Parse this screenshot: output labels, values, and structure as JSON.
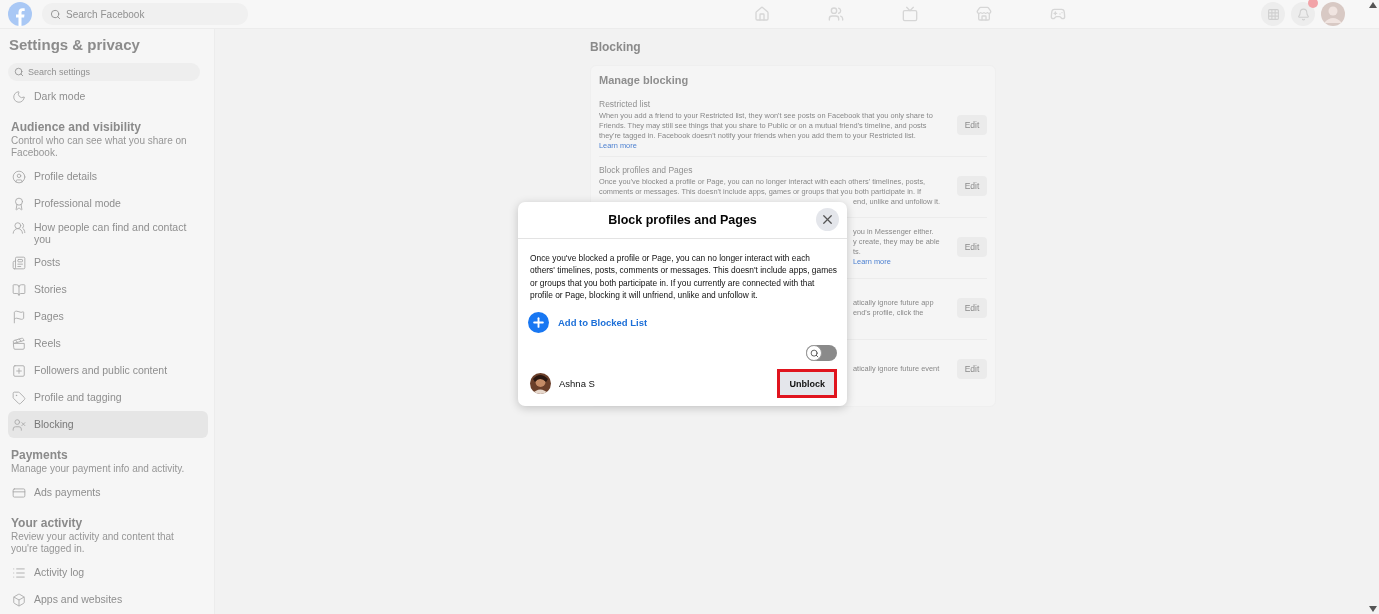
{
  "topbar": {
    "search": {
      "placeholder": "Search Facebook"
    },
    "nav": [
      {
        "kind": "home",
        "selected": false
      },
      {
        "kind": "friends",
        "selected": false
      },
      {
        "kind": "video",
        "selected": false
      },
      {
        "kind": "marketplace",
        "selected": false
      },
      {
        "kind": "gaming",
        "selected": false
      }
    ]
  },
  "sidebar": {
    "title": "Settings & privacy",
    "search": {
      "placeholder": "Search settings"
    },
    "entries": [
      {
        "kind": "item",
        "label": "Dark mode",
        "selected": false
      },
      {
        "kind": "section",
        "label": "Audience and visibility",
        "description": "Control who can see what you share on Facebook."
      },
      {
        "kind": "item",
        "label": "Profile details",
        "selected": false
      },
      {
        "kind": "item",
        "label": "Professional mode",
        "selected": false
      },
      {
        "kind": "item",
        "label": "How people can find and contact you",
        "selected": false
      },
      {
        "kind": "item",
        "label": "Posts",
        "selected": false
      },
      {
        "kind": "item",
        "label": "Stories",
        "selected": false
      },
      {
        "kind": "item",
        "label": "Pages",
        "selected": false
      },
      {
        "kind": "item",
        "label": "Reels",
        "selected": false
      },
      {
        "kind": "item",
        "label": "Followers and public content",
        "selected": false
      },
      {
        "kind": "item",
        "label": "Profile and tagging",
        "selected": false
      },
      {
        "kind": "item",
        "label": "Blocking",
        "selected": true
      },
      {
        "kind": "section",
        "label": "Payments",
        "description": "Manage your payment info and activity."
      },
      {
        "kind": "item",
        "label": "Ads payments",
        "selected": false
      },
      {
        "kind": "section",
        "label": "Your activity",
        "description": "Review your activity and content that you're tagged in."
      },
      {
        "kind": "item",
        "label": "Activity log",
        "selected": false
      },
      {
        "kind": "item",
        "label": "Apps and websites",
        "selected": false
      }
    ]
  },
  "main": {
    "title": "Blocking",
    "card": {
      "title": "Manage blocking",
      "sections": [
        {
          "title": "Restricted list",
          "lines": [
            {
              "kind": "full",
              "text": "When you add a friend to your Restricted list, they won't see posts on Facebook that you only share to Friends. They may still see things that you share to Public or on a mutual friend's timeline, and posts they're tagged in. Facebook doesn't notify your friends when you add them to your Restricted list."
            },
            {
              "kind": "link",
              "text": "Learn more"
            }
          ],
          "action": "Edit"
        },
        {
          "title": "Block profiles and Pages",
          "lines": [
            {
              "kind": "full",
              "text": "Once you've blocked a profile or Page, you can no longer interact with each others' timelines, posts,"
            },
            {
              "kind": "full",
              "text": "comments or messages. This doesn't include apps, games or groups that you both participate in. If"
            },
            {
              "kind": "tail",
              "text": "end, unlike and unfollow it."
            }
          ],
          "action": "Edit"
        },
        {
          "lines": [
            {
              "kind": "tail",
              "text": "you in Messenger either."
            },
            {
              "kind": "tail",
              "text": "y create, they may be able"
            },
            {
              "kind": "tail",
              "text": "ts."
            },
            {
              "kind": "link",
              "text": "Learn more"
            }
          ],
          "action": "Edit"
        },
        {
          "lines": [
            {
              "kind": "tail",
              "text": "atically ignore future app"
            },
            {
              "kind": "tail",
              "text": "end's profile, click the"
            }
          ],
          "action": "Edit"
        },
        {
          "lines": [
            {
              "kind": "tail",
              "text": "atically ignore future event"
            }
          ],
          "action": "Edit"
        }
      ]
    }
  },
  "dialog": {
    "title": "Block profiles and Pages",
    "text": "Once you've blocked a profile or Page, you can no longer interact with each others' timelines, posts, comments or messages. This doesn't include apps, games or groups that you both participate in. If you currently are connected with that profile or Page, blocking it will unfriend, unlike and unfollow it.",
    "add_label": "Add to Blocked List",
    "search_toggle": {
      "on": false
    },
    "blocked": [
      {
        "name": "Ashna S",
        "action": "Unblock",
        "highlighted": true
      }
    ]
  }
}
